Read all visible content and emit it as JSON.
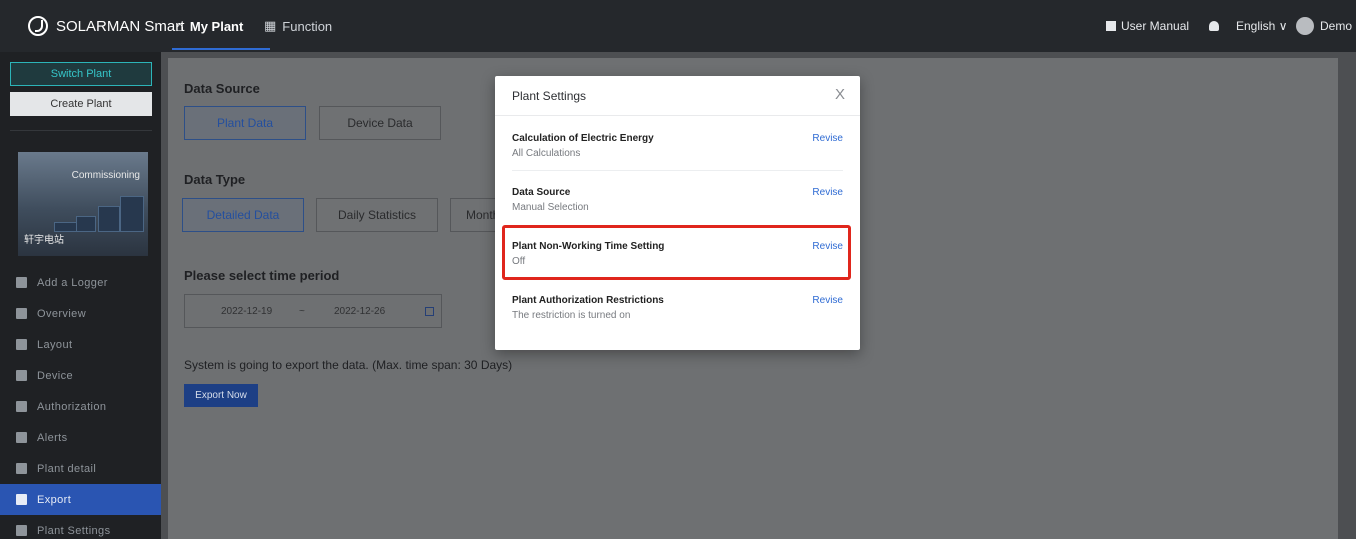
{
  "topbar": {
    "brand": "SOLARMAN Smart",
    "nav": [
      {
        "label": "My Plant",
        "icon": "home-icon"
      },
      {
        "label": "Function",
        "icon": "function-icon"
      }
    ],
    "user_manual": "User Manual",
    "language": "English ∨",
    "username": "Demo"
  },
  "sidebar": {
    "switch_plant": "Switch Plant",
    "create_plant": "Create Plant",
    "plant": {
      "status": "Commissioning",
      "name": "轩宇电站"
    },
    "menu": [
      {
        "label": "Add a Logger",
        "icon": "add-icon"
      },
      {
        "label": "Overview",
        "icon": "chart-icon"
      },
      {
        "label": "Layout",
        "icon": "layout-icon"
      },
      {
        "label": "Device",
        "icon": "device-icon"
      },
      {
        "label": "Authorization",
        "icon": "shield-icon"
      },
      {
        "label": "Alerts",
        "icon": "alarm-icon"
      },
      {
        "label": "Plant detail",
        "icon": "detail-icon"
      },
      {
        "label": "Export",
        "icon": "export-icon",
        "active": true
      },
      {
        "label": "Plant Settings",
        "icon": "gear-icon"
      }
    ]
  },
  "main": {
    "data_source_title": "Data Source",
    "data_source_options": [
      "Plant Data",
      "Device Data"
    ],
    "data_type_title": "Data Type",
    "data_type_options": [
      "Detailed Data",
      "Daily Statistics",
      "Monthl"
    ],
    "time_title": "Please select time period",
    "date_start": "2022-12-19",
    "date_sep": "~",
    "date_end": "2022-12-26",
    "note": "System is going to export the data. (Max. time span: 30 Days)",
    "export_button": "Export Now"
  },
  "modal": {
    "title": "Plant Settings",
    "close": "X",
    "rows": [
      {
        "label": "Calculation of Electric Energy",
        "value": "All Calculations",
        "action": "Revise"
      },
      {
        "label": "Data Source",
        "value": "Manual Selection",
        "action": "Revise"
      },
      {
        "label": "Plant Non-Working Time Setting",
        "value": "Off",
        "action": "Revise"
      },
      {
        "label": "Plant Authorization Restrictions",
        "value": "The restriction is turned on",
        "action": "Revise"
      }
    ]
  },
  "colors": {
    "accent": "#2f6bd3",
    "highlight": "#e0261c",
    "sidebar_active": "#2a55b2"
  }
}
